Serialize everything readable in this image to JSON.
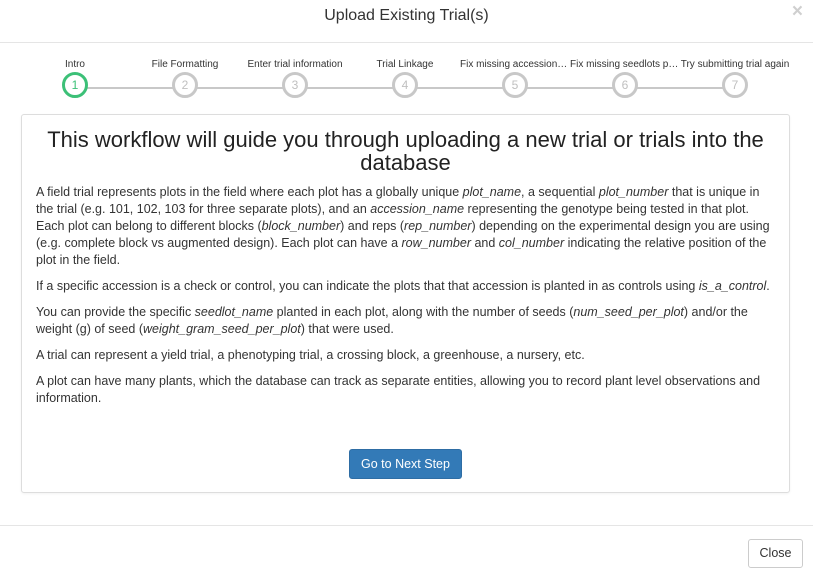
{
  "modal": {
    "title": "Upload Existing Trial(s)",
    "close_glyph": "×"
  },
  "stepper": {
    "active_step": 1,
    "accent_color": "#3cc077",
    "inactive_color": "#c8c8c8",
    "steps": [
      {
        "number": "1",
        "label": "Intro"
      },
      {
        "number": "2",
        "label": "File Formatting"
      },
      {
        "number": "3",
        "label": "Enter trial information"
      },
      {
        "number": "4",
        "label": "Trial Linkage"
      },
      {
        "number": "5",
        "label": "Fix missing accessions in database"
      },
      {
        "number": "6",
        "label": "Fix missing seedlots possibly"
      },
      {
        "number": "7",
        "label": "Try submitting trial again"
      }
    ]
  },
  "panel": {
    "heading": "This workflow will guide you through uploading a new trial or trials into the database",
    "p1": {
      "t1": "A field trial represents plots in the field where each plot has a globally unique ",
      "e1": "plot_name",
      "t2": ", a sequential ",
      "e2": "plot_number",
      "t3": " that is unique in the trial (e.g. 101, 102, 103 for three separate plots), and an ",
      "e3": "accession_name",
      "t4": " representing the genotype being tested in that plot. Each plot can belong to different blocks (",
      "e4": "block_number",
      "t5": ") and reps (",
      "e5": "rep_number",
      "t6": ") depending on the experimental design you are using (e.g. complete block vs augmented design). Each plot can have a ",
      "e6": "row_number",
      "t7": " and ",
      "e7": "col_number",
      "t8": " indicating the relative position of the plot in the field."
    },
    "p2": {
      "t1": "If a specific accession is a check or control, you can indicate the plots that that accession is planted in as controls using ",
      "e1": "is_a_control",
      "t2": "."
    },
    "p3": {
      "t1": "You can provide the specific ",
      "e1": "seedlot_name",
      "t2": " planted in each plot, along with the number of seeds (",
      "e2": "num_seed_per_plot",
      "t3": ") and/or the weight (g) of seed (",
      "e3": "weight_gram_seed_per_plot",
      "t4": ") that were used."
    },
    "p4": "A trial can represent a yield trial, a phenotyping trial, a crossing block, a greenhouse, a nursery, etc.",
    "p5": "A plot can have many plants, which the database can track as separate entities, allowing you to record plant level observations and information.",
    "next_button": "Go to Next Step",
    "button_color": "#337ab7"
  },
  "footer": {
    "close_button": "Close"
  }
}
